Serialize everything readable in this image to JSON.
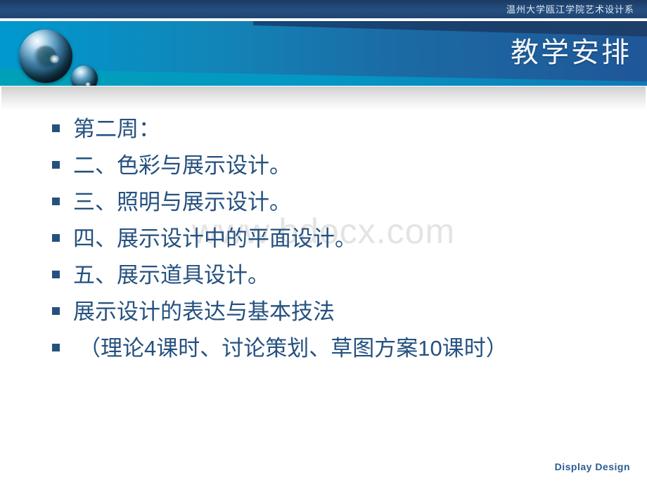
{
  "topbar": {
    "org_title": "温州大学瓯江学院艺术设计系"
  },
  "header": {
    "title": "教学安排",
    "logo_sphere_large": "sphere-icon",
    "logo_sphere_small": "sphere-icon"
  },
  "watermark": {
    "text": "www.bdocx.com"
  },
  "content": {
    "bullets": [
      {
        "text": "第二周：",
        "indented": false
      },
      {
        "text": "二、色彩与展示设计。",
        "indented": false
      },
      {
        "text": "三、照明与展示设计。",
        "indented": false
      },
      {
        "text": "四、展示设计中的平面设计。",
        "indented": false
      },
      {
        "text": "五、展示道具设计。",
        "indented": false
      },
      {
        "text": "展示设计的表达与基本技法",
        "indented": false
      },
      {
        "text": "（理论4课时、讨论策划、草图方案10课时）",
        "indented": true
      }
    ]
  },
  "footer": {
    "label": "Display Design"
  },
  "colors": {
    "topbar_navy": "#254f7f",
    "banner_blue": "#1f5799",
    "banner_cyan": "#0095cc",
    "banner_dark_wedge": "#1b3a63",
    "text_navy": "#25517f",
    "watermark_gray": "#e4e4e4",
    "footer_blue": "#2c5c92"
  }
}
